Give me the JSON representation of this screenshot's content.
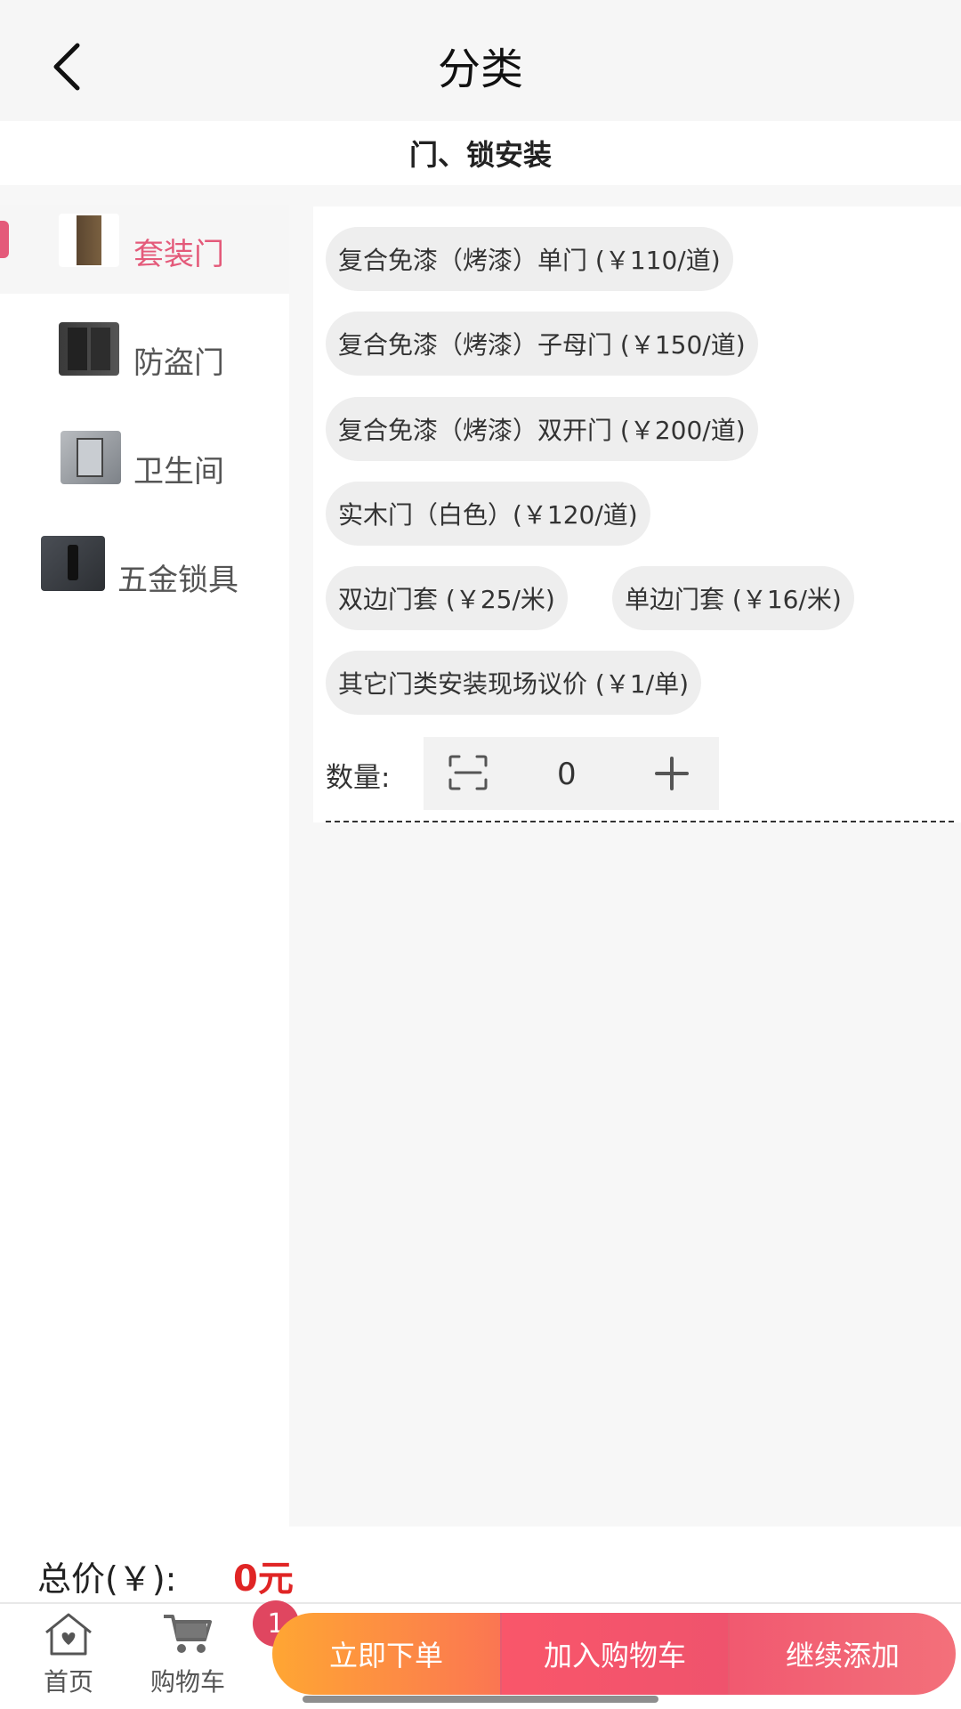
{
  "header": {
    "title": "分类"
  },
  "section": {
    "title": "门、锁安装"
  },
  "sidebar": {
    "items": [
      {
        "label": "套装门",
        "active": true
      },
      {
        "label": "防盗门",
        "active": false
      },
      {
        "label": "卫生间",
        "active": false
      },
      {
        "label": "五金锁具",
        "active": false
      }
    ]
  },
  "options": [
    "复合免漆（烤漆）单门 (￥110/道)",
    "复合免漆（烤漆）子母门 (￥150/道)",
    "复合免漆（烤漆）双开门 (￥200/道)",
    "实木门（白色）(￥120/道)",
    "双边门套 (￥25/米)",
    "单边门套 (￥16/米)",
    "其它门类安装现场议价 (￥1/单)"
  ],
  "quantity": {
    "label": "数量:",
    "value": "0"
  },
  "total": {
    "label": "总价(￥):",
    "value": "0元"
  },
  "tabbar": {
    "home": "首页",
    "cart": "购物车",
    "cart_badge": "1"
  },
  "actions": {
    "order": "立即下单",
    "add_cart": "加入购物车",
    "continue": "继续添加"
  },
  "colors": {
    "accent": "#e45a7a",
    "price": "#e02525",
    "order_gradient_start": "#ffa633",
    "cart_gradient": "#f9566a"
  }
}
